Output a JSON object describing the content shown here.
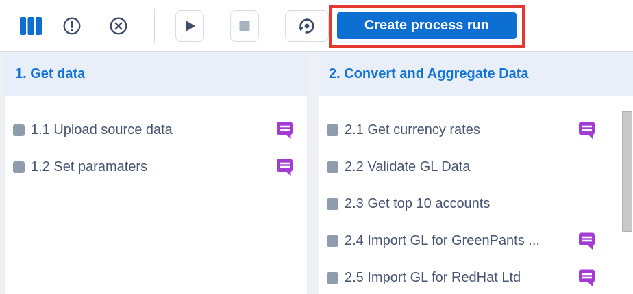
{
  "toolbar": {
    "create_button_label": "Create process run",
    "icons": {
      "board_columns": "board-columns-icon",
      "error_circle": "error-circle-icon",
      "cancel_circle": "cancel-circle-icon",
      "play": "play-icon",
      "stop": "stop-icon",
      "history_reset": "history-reset-icon"
    }
  },
  "colors": {
    "accent_blue": "#0e6fd3",
    "header_text_blue": "#1473d6",
    "item_text": "#485571",
    "status_square": "#8e9cad",
    "comment_purple": "#a43bd4",
    "annotation_red": "#e4392f",
    "icon_navy": "#3e4b69",
    "column_header_bg": "#e9eff8",
    "page_bg": "#eef0f3"
  },
  "columns": [
    {
      "title": "1. Get data",
      "has_scrollbar": false,
      "items": [
        {
          "label": "1.1 Upload source data",
          "has_comment": true
        },
        {
          "label": "1.2 Set paramaters",
          "has_comment": true
        }
      ]
    },
    {
      "title": "2. Convert and Aggregate Data",
      "has_scrollbar": true,
      "items": [
        {
          "label": "2.1 Get currency rates",
          "has_comment": true
        },
        {
          "label": "2.2 Validate GL Data",
          "has_comment": false
        },
        {
          "label": "2.3 Get top 10 accounts",
          "has_comment": false
        },
        {
          "label": "2.4 Import GL for GreenPants ...",
          "has_comment": true
        },
        {
          "label": "2.5 Import GL for RedHat Ltd",
          "has_comment": true
        }
      ]
    }
  ]
}
